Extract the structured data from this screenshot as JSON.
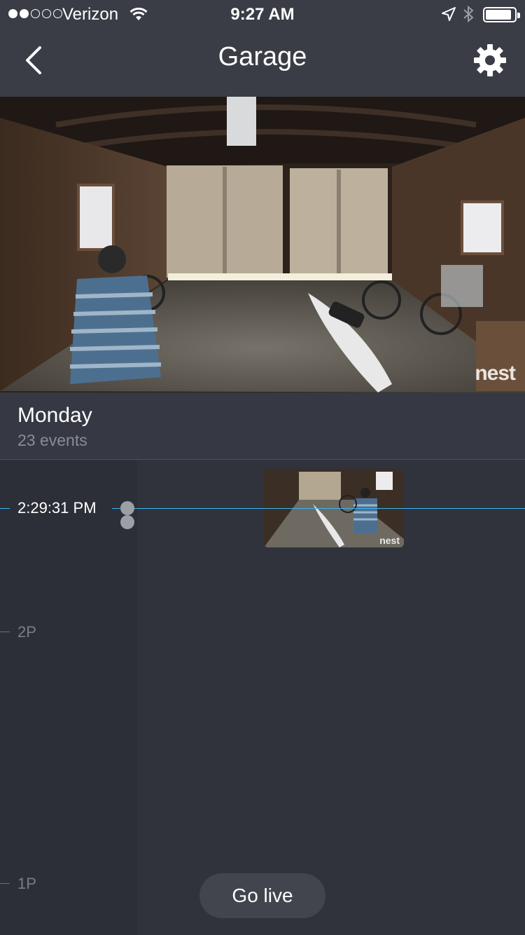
{
  "status_bar": {
    "carrier": "Verizon",
    "time": "9:27 AM",
    "signal_bars_filled": 2,
    "signal_bars_total": 5,
    "battery_level": 0.85
  },
  "nav": {
    "title": "Garage",
    "back_icon": "chevron-left-icon",
    "settings_icon": "gear-icon"
  },
  "feed": {
    "watermark": "nest"
  },
  "day": {
    "name": "Monday",
    "events": "23 events"
  },
  "timeline": {
    "current_time": "2:29:31 PM",
    "labels": [
      "2P",
      "1P"
    ],
    "thumbnail_watermark": "nest"
  },
  "actions": {
    "go_live": "Go live"
  },
  "colors": {
    "accent": "#3ab4f2",
    "background": "#333640"
  }
}
